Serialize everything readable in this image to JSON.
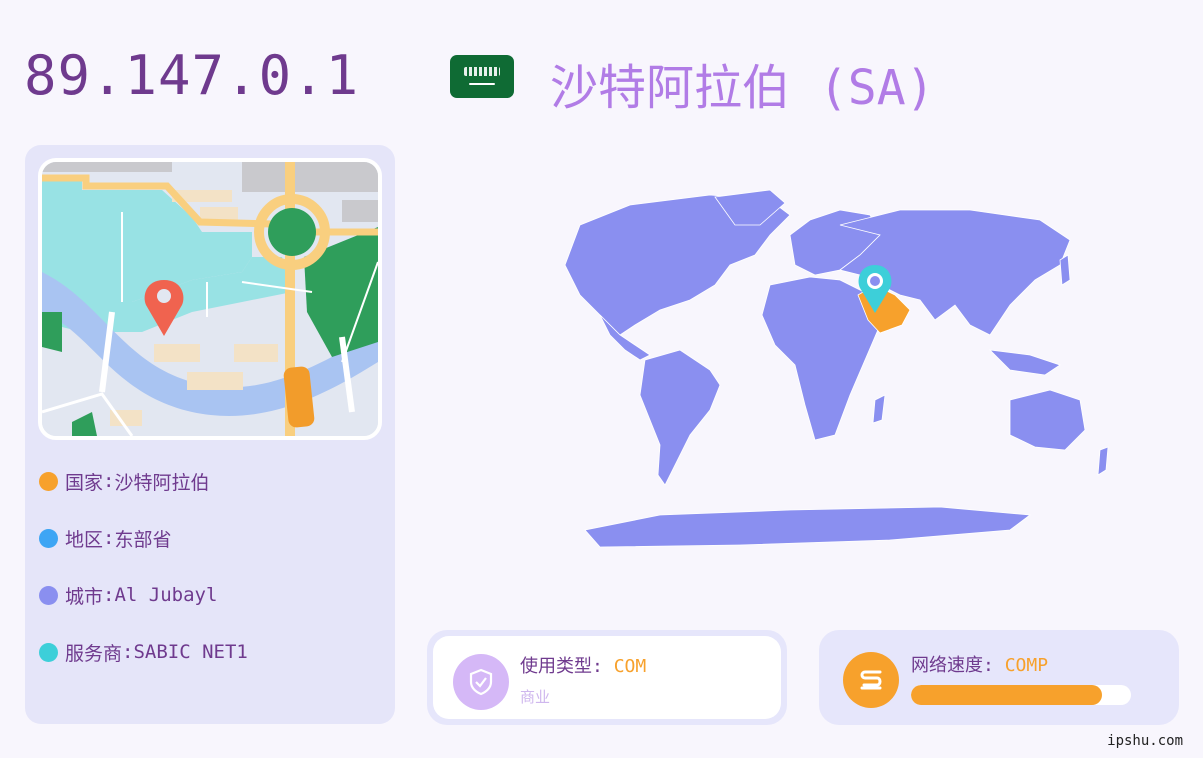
{
  "header": {
    "ip": "89.147.0.1",
    "flag_icon": "saudi-arabia-flag-icon",
    "country_title": "沙特阿拉伯 (SA)"
  },
  "info": {
    "country": {
      "label": "国家",
      "value": "沙特阿拉伯",
      "color": "#f7a12c"
    },
    "region": {
      "label": "地区",
      "value": "东部省",
      "color": "#3da5f4"
    },
    "city": {
      "label": "城市",
      "value": "Al Jubayl",
      "color": "#8a8ff0"
    },
    "isp": {
      "label": "服务商",
      "value": "SABIC NET1",
      "color": "#3dcfd9"
    }
  },
  "usage": {
    "label": "使用类型",
    "value": "COM",
    "sub": "商业",
    "icon": "shield-check-icon"
  },
  "speed": {
    "label": "网络速度",
    "value": "COMP",
    "progress": 0.87,
    "icon": "speed-s-icon"
  },
  "footer": {
    "site": "ipshu.com"
  },
  "colors": {
    "accent_orange": "#f7a12c",
    "map_land": "#8a8ff0",
    "highlight_country": "#f7a12c",
    "pin_teal": "#3dcfd9",
    "pin_red": "#f0634f"
  }
}
